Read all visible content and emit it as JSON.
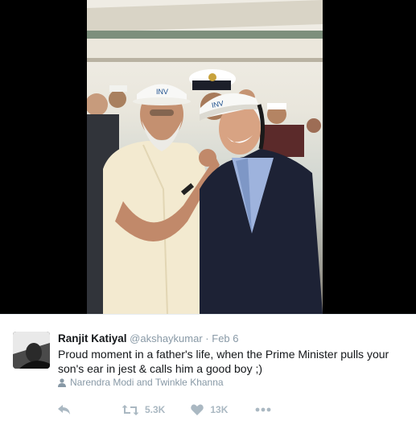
{
  "tweet": {
    "display_name": "Ranjit Katiyal",
    "handle": "@akshaykumar",
    "separator": "·",
    "timestamp": "Feb 6",
    "text": "Proud moment in a father's life, when the Prime Minister pulls your son's ear in jest & calls him a good boy ;)",
    "tagged_people": "Narendra Modi and Twinkle Khanna"
  },
  "actions": {
    "retweet_count": "5.3K",
    "like_count": "13K"
  },
  "icons": {
    "reply": "reply-icon",
    "retweet": "retweet-icon",
    "like": "heart-icon",
    "more": "more-icon",
    "tagged": "person-icon"
  },
  "colors": {
    "text": "#14171a",
    "muted": "#8899a6",
    "action": "#aab8c2",
    "media_background": "#000000"
  }
}
